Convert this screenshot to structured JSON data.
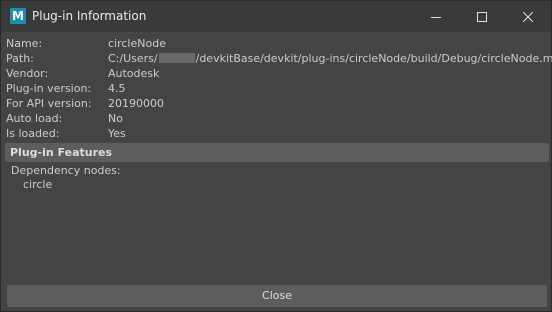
{
  "window": {
    "title": "Plug-in Information",
    "app_icon_letter": "M"
  },
  "info": {
    "rows": [
      {
        "label": "Name:",
        "value": "circleNode"
      },
      {
        "label": "Path:",
        "value_prefix": "C:/Users/",
        "value_suffix": "/devkitBase/devkit/plug-ins/circleNode/build/Debug/circleNode.mll"
      },
      {
        "label": "Vendor:",
        "value": "Autodesk"
      },
      {
        "label": "Plug-in version:",
        "value": "4.5"
      },
      {
        "label": "For API version:",
        "value": "20190000"
      },
      {
        "label": "Auto load:",
        "value": "No"
      },
      {
        "label": "Is loaded:",
        "value": "Yes"
      }
    ]
  },
  "features": {
    "header": "Plug-in Features",
    "dependency_label": "Dependency nodes:",
    "dependency_nodes": [
      "circle"
    ]
  },
  "footer": {
    "close_label": "Close"
  },
  "colors": {
    "background": "#444444",
    "titlebar": "#3a3a3a",
    "section_header": "#5d5d5d",
    "button": "#5d5d5d",
    "text": "#cccccc"
  }
}
